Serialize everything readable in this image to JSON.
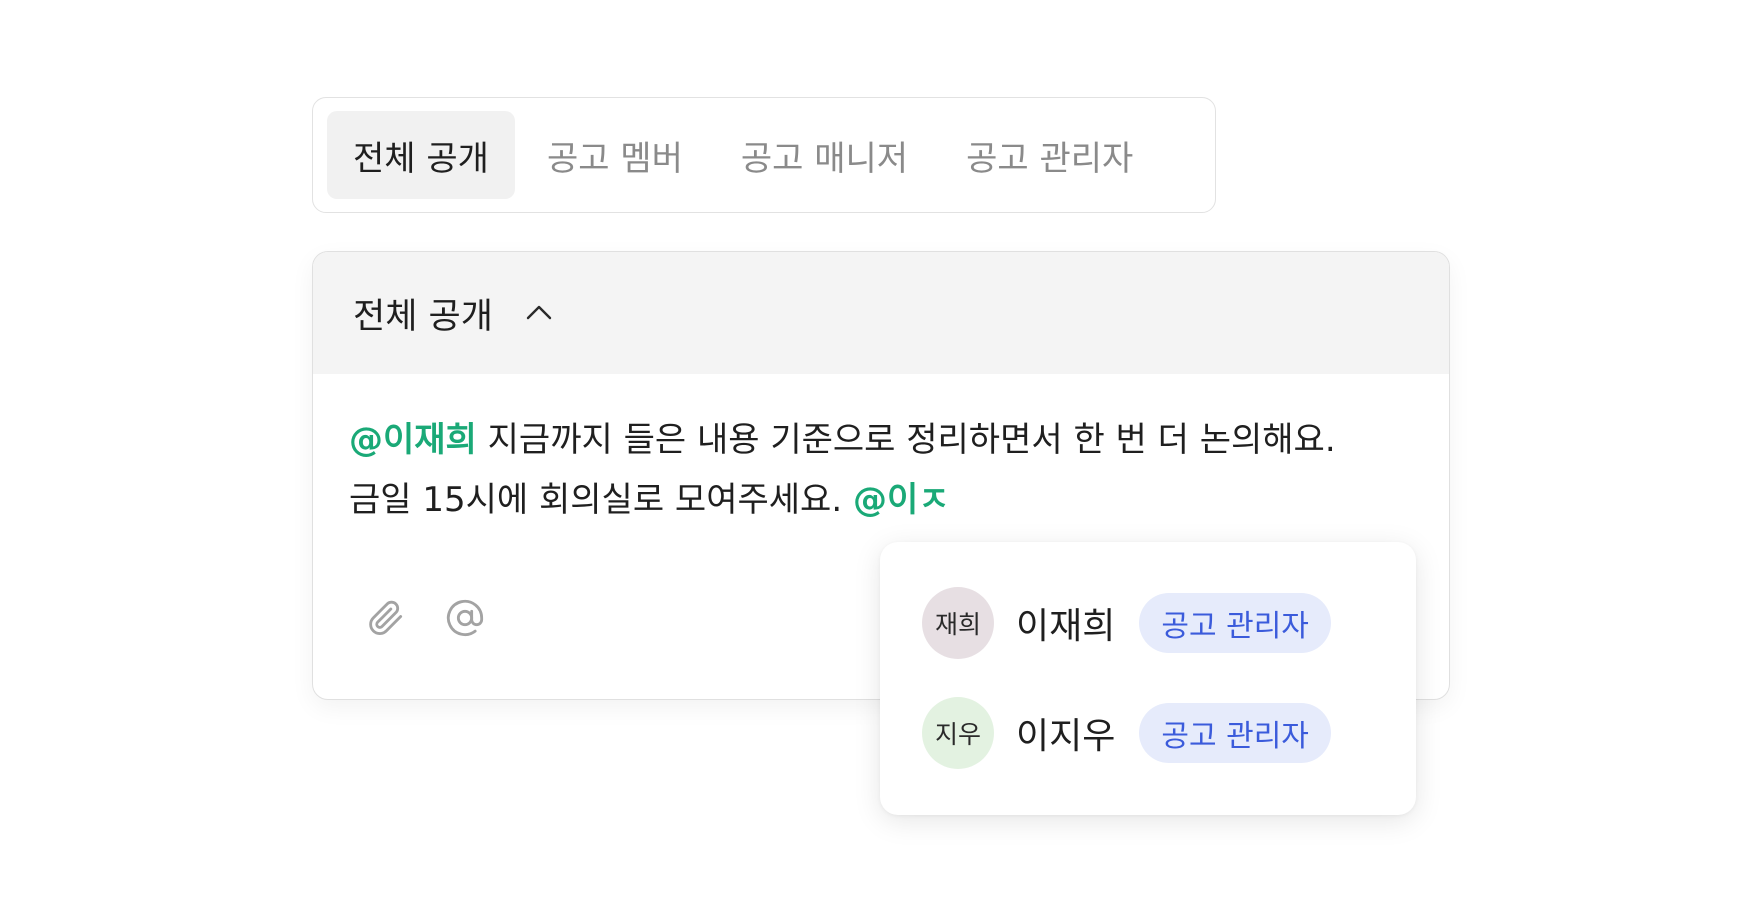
{
  "tabs": [
    {
      "label": "전체 공개",
      "active": true
    },
    {
      "label": "공고 멤버",
      "active": false
    },
    {
      "label": "공고 매니저",
      "active": false
    },
    {
      "label": "공고 관리자",
      "active": false
    }
  ],
  "composer": {
    "header_title": "전체 공개",
    "header_icon": "chevron-up-icon",
    "body": {
      "line1_mention": "@이재희",
      "line1_text": " 지금까지 들은 내용 기준으로 정리하면서 한 번 더 논의해요.",
      "line2_text": "금일 15시에 회의실로 모여주세요. ",
      "line2_mention": "@이ㅈ"
    },
    "toolbar": {
      "attach_icon": "paperclip-icon",
      "mention_icon": "at-sign-icon"
    }
  },
  "mention_dropdown": {
    "options": [
      {
        "avatar_text": "재희",
        "name": "이재희",
        "role": "공고 관리자",
        "avatar_color": "#e7dfe3"
      },
      {
        "avatar_text": "지우",
        "name": "이지우",
        "role": "공고 관리자",
        "avatar_color": "#e3f2e1"
      }
    ]
  },
  "colors": {
    "mention": "#1aa977",
    "badge_bg": "#e6ebfb",
    "badge_text": "#3b5bdb",
    "header_bg": "#f4f4f4",
    "active_tab_bg": "#f1f1f1"
  }
}
